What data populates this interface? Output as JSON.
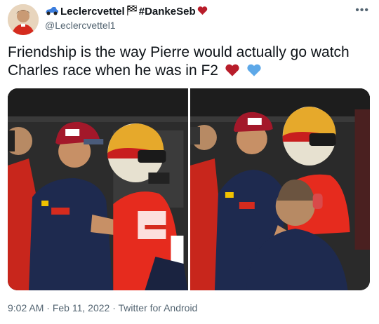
{
  "header": {
    "display_name": "Leclercvettel",
    "hashtag": "#DankeSeb",
    "handle": "@Leclercvettel1"
  },
  "tweet": {
    "text": "Friendship is the way Pierre would actually go watch Charles race when he was in F2"
  },
  "media": {
    "photos": [
      {
        "icon": "photo-pierre-charles-pitlane-1"
      },
      {
        "icon": "photo-pierre-charles-pitlane-2"
      }
    ]
  },
  "footer": {
    "time": "9:02 AM",
    "separator1": " · ",
    "date": "Feb 11, 2022",
    "separator2": " · ",
    "source": "Twitter for Android"
  },
  "colors": {
    "ferrari_red": "#d52b1e",
    "redbull_navy": "#1e2a4f",
    "muted": "#536471"
  },
  "icons": {
    "more": "more-dots-icon",
    "car": "race-car-emoji",
    "flag": "checkered-flag-emoji",
    "red_heart": "red-heart-emoji",
    "blue_heart": "blue-heart-emoji"
  }
}
